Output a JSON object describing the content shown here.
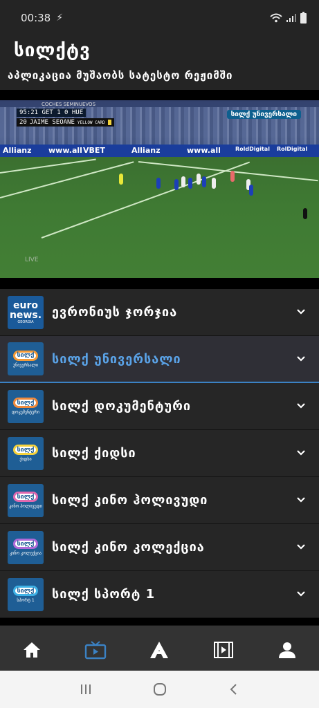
{
  "status_bar": {
    "time": "00:38",
    "charging_icon": "bolt-icon",
    "wifi_icon": "wifi-icon",
    "signal_icon": "signal-icon",
    "battery_icon": "battery-icon"
  },
  "header": {
    "title": "სილქტვ",
    "subtitle": "აპლიკაცია მუშაობს სატესტო რეჟიმში"
  },
  "player": {
    "scoreboard_time": "95:21",
    "home": "GET",
    "home_score": "1",
    "away_score": "0",
    "away": "HUE",
    "player_number": "20",
    "player_name": "JAIME SEOANE",
    "card": "YELLOW CARD",
    "stand_sign": "COCHES SEMINUEVOS",
    "channel_bug": "სილქ უნივერსალი",
    "live": "LIVE",
    "ads": [
      "Allianz",
      "www.all",
      "Allianz",
      "VBET",
      "RoldDigital",
      "www.all",
      "RolDigital"
    ]
  },
  "channels": [
    {
      "name": "ევრონიუს ჯორჯია",
      "logo": "euronews",
      "logo_text": "euro news.",
      "logo_sub": "GEORGIA",
      "active": false,
      "accent": "#1a5a9a"
    },
    {
      "name": "სილქ უნივერსალი",
      "logo": "silk",
      "logo_text": "სილქ",
      "logo_sub": "უნივერსალი",
      "active": true,
      "accent": "#f59b37"
    },
    {
      "name": "სილქ დოკუმენტური",
      "logo": "silk",
      "logo_text": "სილქ",
      "logo_sub": "დოკუმენტური",
      "active": false,
      "accent": "#f08a3c"
    },
    {
      "name": "სილქ ქიდსი",
      "logo": "silk",
      "logo_text": "სილქ",
      "logo_sub": "ქიდსი",
      "active": false,
      "accent": "#f5d23c"
    },
    {
      "name": "სილქ კინო ჰოლივუდი",
      "logo": "silk",
      "logo_text": "სილქ",
      "logo_sub": "კინო ჰოლივუდი",
      "active": false,
      "accent": "#e06ab0"
    },
    {
      "name": "სილქ კინო კოლექცია",
      "logo": "silk",
      "logo_text": "სილქ",
      "logo_sub": "კინო კოლექცია",
      "active": false,
      "accent": "#b06ad8"
    },
    {
      "name": "სილქ სპორტ 1",
      "logo": "silk",
      "logo_text": "სილქ",
      "logo_sub": "სპორტ 1",
      "active": false,
      "accent": "#3fb2e6"
    }
  ],
  "bottom_nav": [
    {
      "icon": "home-icon",
      "active": false
    },
    {
      "icon": "tv-icon",
      "active": true
    },
    {
      "icon": "a-logo-icon",
      "active": false
    },
    {
      "icon": "film-icon",
      "active": false
    },
    {
      "icon": "user-icon",
      "active": false
    }
  ],
  "colors": {
    "accent": "#3b82c4",
    "background": "#262626",
    "header": "#242424"
  },
  "system_nav": [
    "recent-apps-icon",
    "home-circle-icon",
    "back-icon"
  ]
}
